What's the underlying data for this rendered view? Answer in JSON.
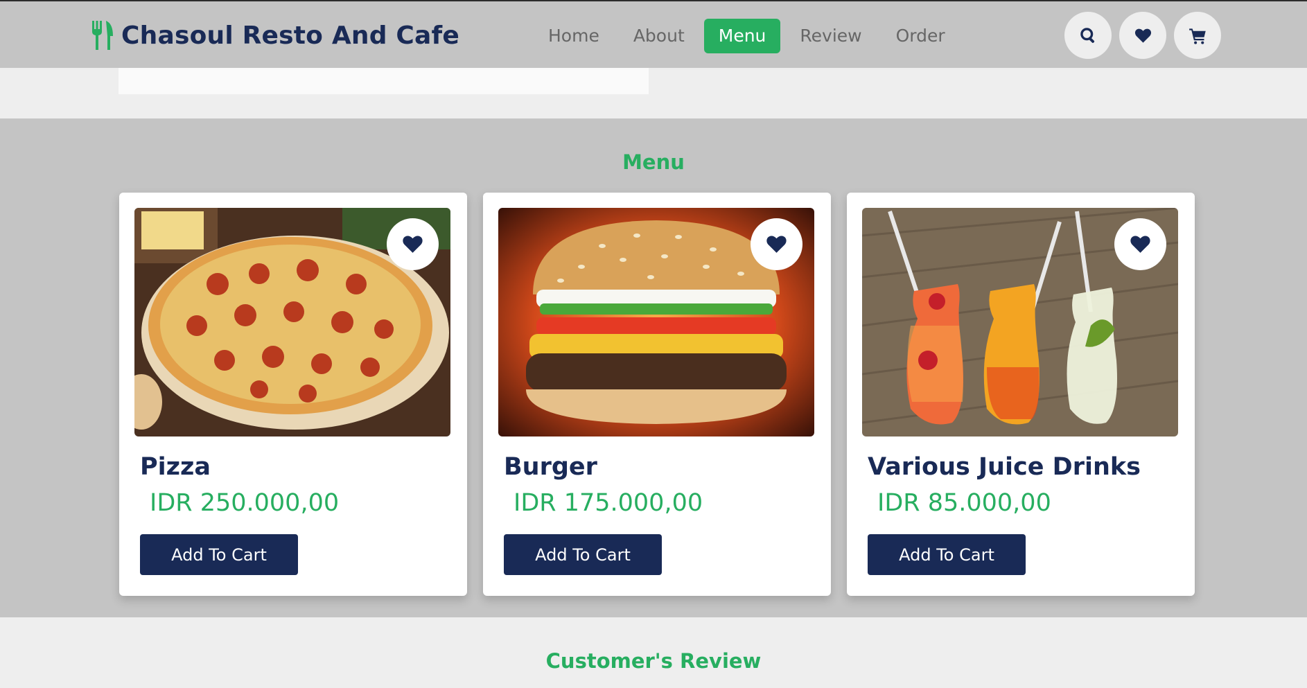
{
  "header": {
    "brand": "Chasoul Resto And Cafe",
    "brand_icon": "utensils-icon",
    "nav": [
      {
        "label": "Home",
        "active": false
      },
      {
        "label": "About",
        "active": false
      },
      {
        "label": "Menu",
        "active": true
      },
      {
        "label": "Review",
        "active": false
      },
      {
        "label": "Order",
        "active": false
      }
    ],
    "icons": [
      "search-icon",
      "heart-icon",
      "cart-icon"
    ]
  },
  "menu": {
    "title": "Menu",
    "items": [
      {
        "name": "Pizza",
        "price": "IDR 250.000,00",
        "button": "Add To Cart",
        "image": "pizza-image"
      },
      {
        "name": "Burger",
        "price": "IDR 175.000,00",
        "button": "Add To Cart",
        "image": "burger-image"
      },
      {
        "name": "Various Juice Drinks",
        "price": "IDR 85.000,00",
        "button": "Add To Cart",
        "image": "juice-drinks-image"
      }
    ]
  },
  "review": {
    "title": "Customer's Review"
  },
  "colors": {
    "accent": "#27ae60",
    "primary": "#192a56",
    "header_bg": "#c4c4c4",
    "page_bg": "#eeeeee"
  }
}
